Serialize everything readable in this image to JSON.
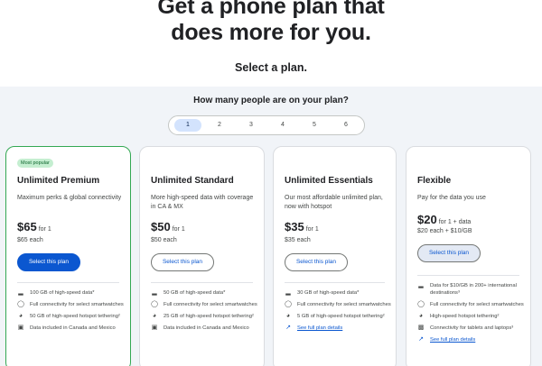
{
  "hero": {
    "title_line1": "Get a phone plan that",
    "title_line2": "does more for you.",
    "subtitle": "Select a plan."
  },
  "selector": {
    "question": "How many people are on your plan?",
    "options": [
      "1",
      "2",
      "3",
      "4",
      "5",
      "6"
    ],
    "selected": "1"
  },
  "plans": [
    {
      "badge": "Most popular",
      "name": "Unlimited Premium",
      "description": "Maximum perks & global connectivity",
      "price": "$65",
      "price_for": "for 1",
      "each": "$65 each",
      "button": "Select this plan",
      "features": [
        {
          "icon": "signal-bars-icon",
          "text": "100 GB of high-speed data*"
        },
        {
          "icon": "watch-icon",
          "text": "Full connectivity for select smartwatches"
        },
        {
          "icon": "hotspot-icon",
          "text": "50 GB of high-speed hotspot tethering²"
        },
        {
          "icon": "luggage-icon",
          "text": "Data included in Canada and Mexico"
        }
      ]
    },
    {
      "name": "Unlimited Standard",
      "description": "More high-speed data with coverage in CA & MX",
      "price": "$50",
      "price_for": "for 1",
      "each": "$50 each",
      "button": "Select this plan",
      "features": [
        {
          "icon": "signal-bars-icon",
          "text": "50 GB of high-speed data*"
        },
        {
          "icon": "watch-icon",
          "text": "Full connectivity for select smartwatches"
        },
        {
          "icon": "hotspot-icon",
          "text": "25 GB of high-speed hotspot tethering²"
        },
        {
          "icon": "luggage-icon",
          "text": "Data included in Canada and Mexico"
        }
      ]
    },
    {
      "name": "Unlimited Essentials",
      "description": "Our most affordable unlimited plan, now with hotspot",
      "price": "$35",
      "price_for": "for 1",
      "each": "$35 each",
      "button": "Select this plan",
      "features": [
        {
          "icon": "signal-bars-icon",
          "text": "30 GB of high-speed data*"
        },
        {
          "icon": "watch-icon",
          "text": "Full connectivity for select smartwatches"
        },
        {
          "icon": "hotspot-icon",
          "text": "5 GB of high-speed hotspot tethering²"
        }
      ],
      "link": "See full plan details"
    },
    {
      "name": "Flexible",
      "description": "Pay for the data you use",
      "price": "$20",
      "price_for": "for 1 + data",
      "each": "$20 each + $10/GB",
      "button": "Select this plan",
      "features": [
        {
          "icon": "signal-bars-icon",
          "text": "Data for $10/GB in 200+ international destinations³"
        },
        {
          "icon": "watch-icon",
          "text": "Full connectivity for select smartwatches"
        },
        {
          "icon": "hotspot-icon",
          "text": "High-speed hotspot tethering²"
        },
        {
          "icon": "tablet-icon",
          "text": "Connectivity for tablets and laptops³"
        }
      ],
      "link": "See full plan details"
    }
  ]
}
